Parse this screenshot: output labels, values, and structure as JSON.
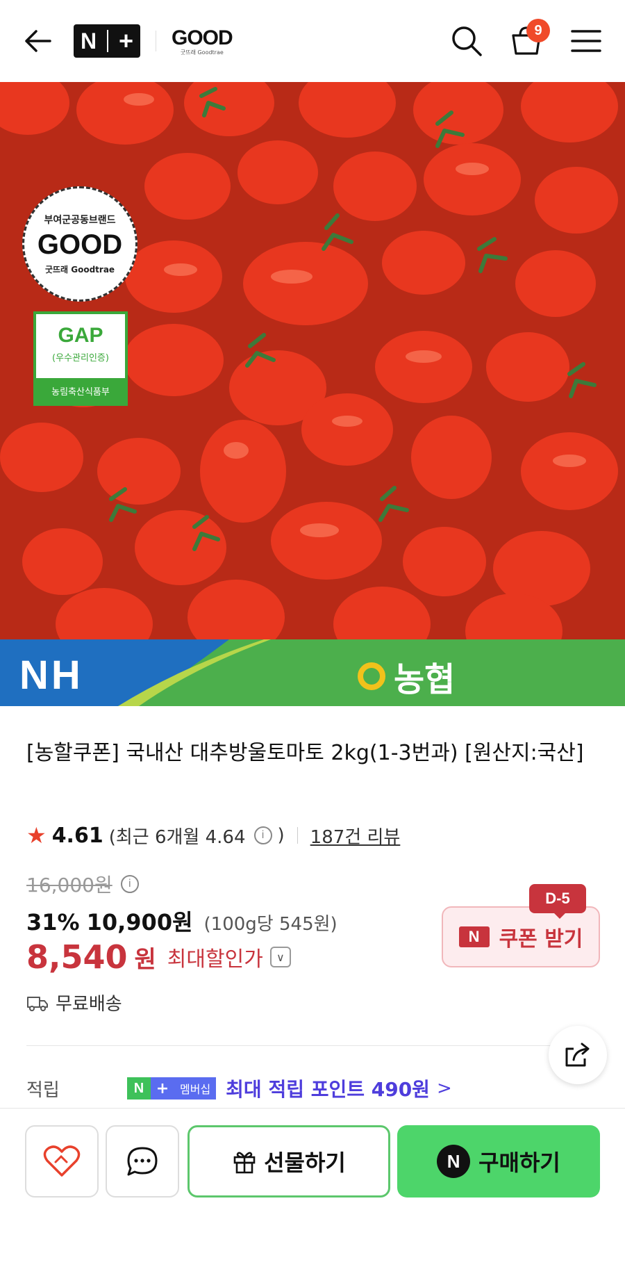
{
  "header": {
    "nplus_n": "N",
    "nplus_plus": "+",
    "brand_word": "GOOD",
    "brand_sub": "굿뜨래 Goodtrae",
    "cart_count": "9"
  },
  "hero": {
    "good_badge_top": "부여군공동브랜드",
    "good_badge_word": "GOOD",
    "good_badge_bottom": "굿뜨래 Goodtrae",
    "gap_title": "GAP",
    "gap_sub": "(우수관리인증)",
    "gap_footer": "농림축산식품부"
  },
  "banner": {
    "nh": "NH",
    "nh_name": "농협"
  },
  "product": {
    "title": "[농할쿠폰] 국내산 대추방울토마토 2kg(1-3번과) [원산지:국산]",
    "rating": "4.61",
    "recent_rating": "(최근 6개월 4.64",
    "recent_close": ")",
    "reviews": "187건 리뷰",
    "original_price": "16,000원",
    "discount_pct": "31%",
    "sale_price": "10,900원",
    "unit_price": "(100g당 545원)",
    "max_price": "8,540",
    "max_won": "원",
    "max_label": "최대할인가",
    "coupon_label": "쿠폰 받기",
    "coupon_mark": "N",
    "dday": "D-5",
    "delivery": "무료배송"
  },
  "points": {
    "label": "적립",
    "mem_n": "N",
    "mem_plus": "+",
    "mem_label": "멤버십",
    "text": "최대 적립 포인트 490원"
  },
  "bottom": {
    "gift": "선물하기",
    "buy": "구매하기",
    "buy_mark": "N"
  },
  "colors": {
    "accent_red": "#c8343d",
    "buy_green": "#4dd56a",
    "point_purple": "#4e3ddc"
  }
}
